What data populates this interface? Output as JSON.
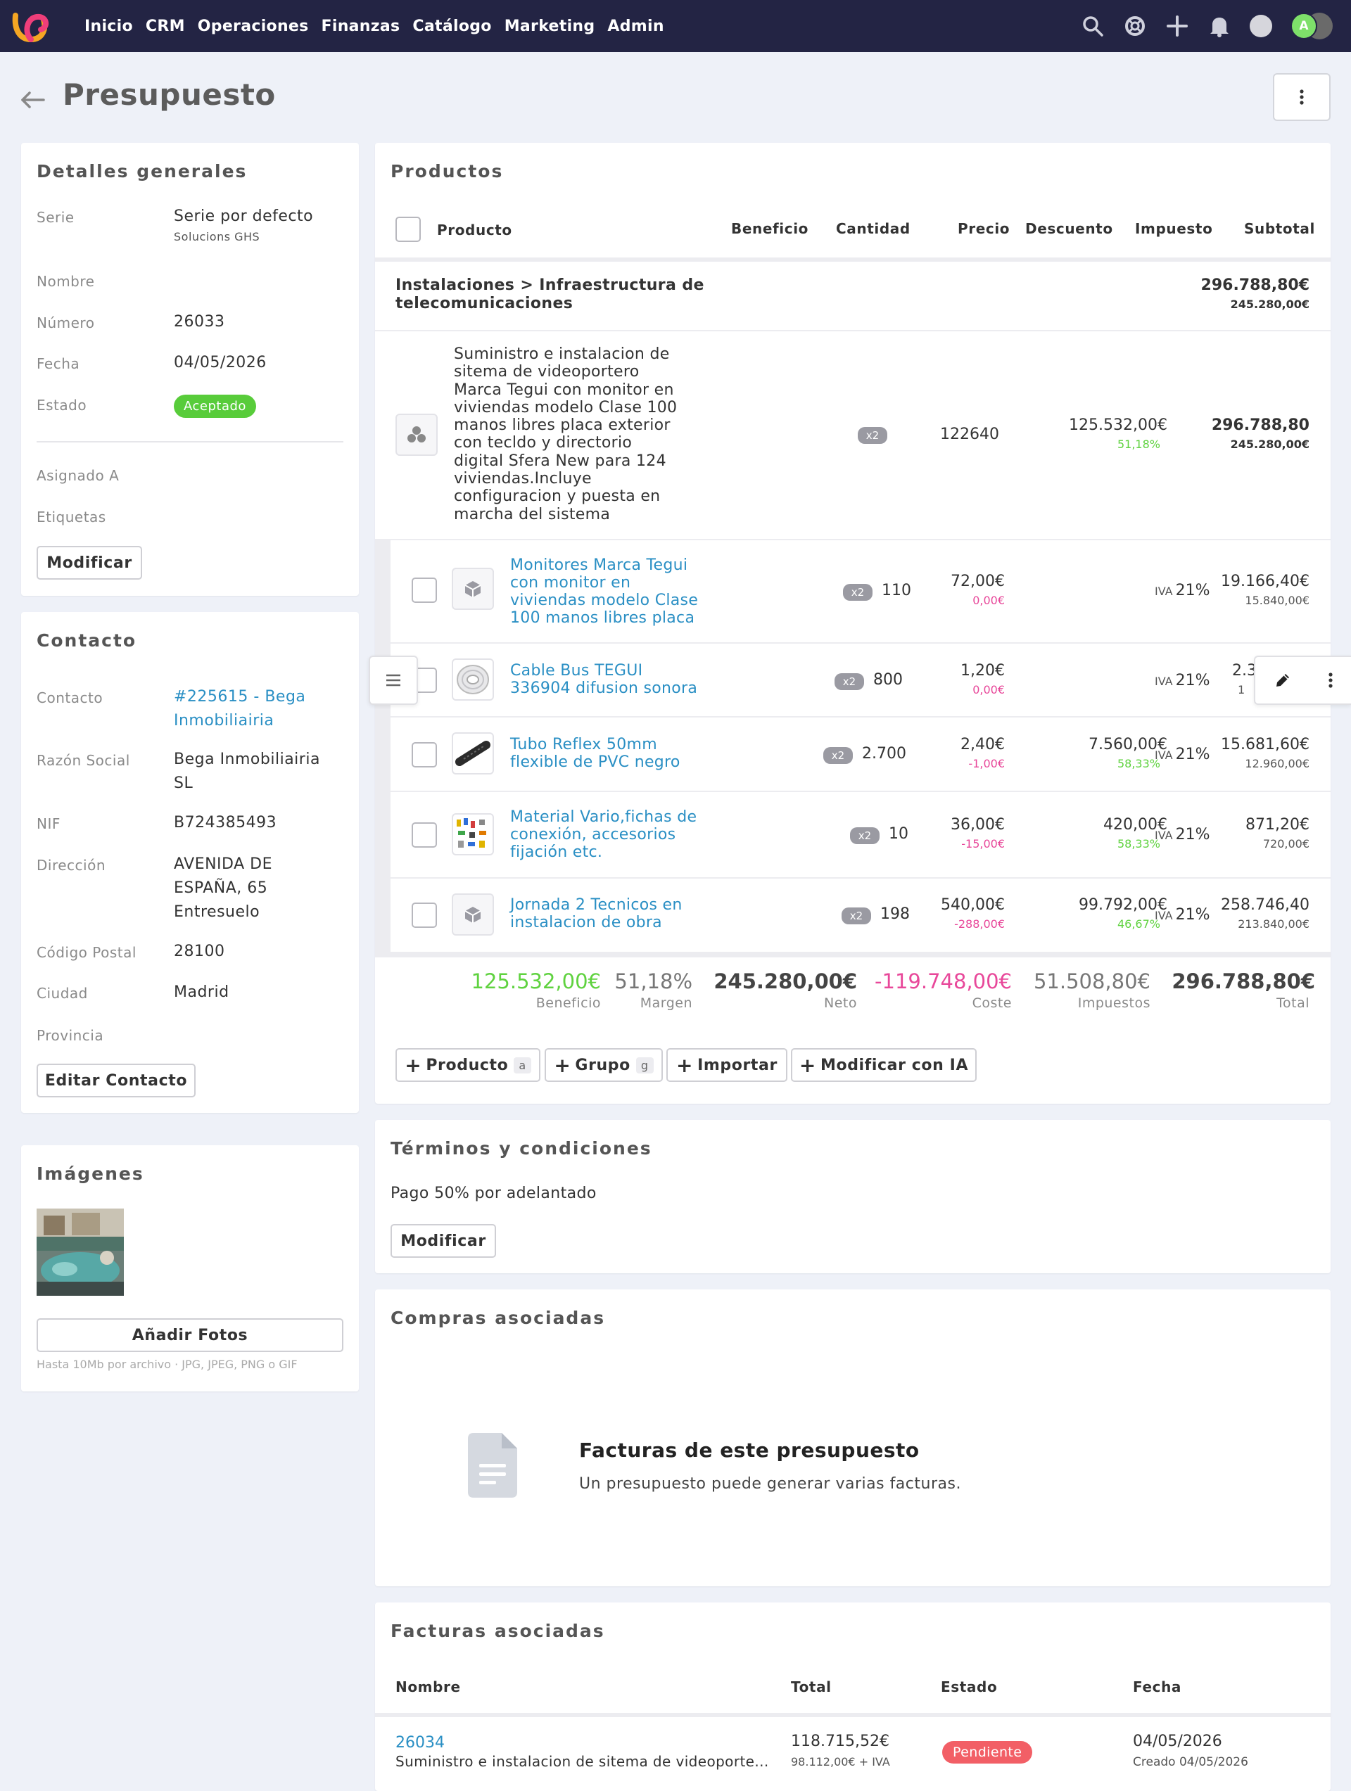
{
  "nav": {
    "links": [
      "Inicio",
      "CRM",
      "Operaciones",
      "Finanzas",
      "Catálogo",
      "Marketing",
      "Admin"
    ],
    "icons": [
      "search-icon",
      "lifebuoy-icon",
      "plus-icon",
      "bell-icon"
    ],
    "avatar_initial": "A"
  },
  "page": {
    "title": "Presupuesto"
  },
  "details": {
    "title": "Detalles generales",
    "serie_label": "Serie",
    "serie_value": "Serie por defecto",
    "serie_sub": "Solucions GHS",
    "nombre_label": "Nombre",
    "numero_label": "Número",
    "numero_value": "26033",
    "fecha_label": "Fecha",
    "fecha_value": "04/05/2026",
    "estado_label": "Estado",
    "estado_value": "Aceptado",
    "asignado_label": "Asignado A",
    "etiquetas_label": "Etiquetas",
    "modify_label": "Modificar"
  },
  "contact": {
    "title": "Contacto",
    "contacto_label": "Contacto",
    "contacto_line1": "#225615 - Bega",
    "contacto_line2": "Inmobiliairia",
    "razon_label": "Razón Social",
    "razon_line1": "Bega Inmobiliairia",
    "razon_line2": "SL",
    "nif_label": "NIF",
    "nif_value": "B724385493",
    "dir_label": "Dirección",
    "dir_line1": "AVENIDA DE",
    "dir_line2": "ESPAÑA, 65",
    "dir_line3": "Entresuelo",
    "cp_label": "Código Postal",
    "cp_value": "28100",
    "ciudad_label": "Ciudad",
    "ciudad_value": "Madrid",
    "provincia_label": "Provincia",
    "edit_label": "Editar Contacto"
  },
  "images": {
    "title": "Imágenes",
    "add_label": "Añadir Fotos",
    "hint": "Hasta 10Mb por archivo · JPG, JPEG, PNG o GIF"
  },
  "products": {
    "title": "Productos",
    "headers": {
      "producto": "Producto",
      "beneficio": "Beneficio",
      "cantidad": "Cantidad",
      "precio": "Precio",
      "descuento": "Descuento",
      "impuesto": "Impuesto",
      "subtotal": "Subtotal"
    },
    "group": {
      "line1": "Instalaciones > Infraestructura de",
      "line2": "telecomunicaciones",
      "total": "296.788,80€",
      "net": "245.280,00€"
    },
    "bundle": {
      "lines": [
        "Suministro e instalacion de",
        "sitema de videoportero",
        "Marca Tegui con monitor en",
        "viviendas modelo Clase 100",
        "manos libres placa exterior",
        "con tecldo y directorio",
        "digital Sfera New para 124",
        "viviendas.Incluye",
        "configuracion y puesta en",
        "marcha del sistema"
      ],
      "benefit": "125.532,00€",
      "margin": "51,18%",
      "qty_pill": "x2",
      "price": "122640",
      "total": "296.788,80",
      "net": "245.280,00€"
    },
    "items": [
      {
        "lines": [
          "Monitores Marca Tegui",
          "con monitor en",
          "viviendas modelo Clase",
          "100 manos libres placa"
        ],
        "benefit": "",
        "margin": "",
        "pill": "x2",
        "qty": "110",
        "price": "72,00€",
        "discount": "0,00€",
        "tax_label": "IVA",
        "tax": "21%",
        "subtotal": "19.166,40€",
        "net": "15.840,00€",
        "thumb": "box-icon"
      },
      {
        "lines": [
          "Cable Bus TEGUI",
          "336904 difusion sonora"
        ],
        "benefit": "",
        "margin": "",
        "pill": "x2",
        "qty": "800",
        "price": "1,20€",
        "discount": "0,00€",
        "tax_label": "IVA",
        "tax": "21%",
        "subtotal": "2.3",
        "net": "1",
        "thumb": "cable-icon"
      },
      {
        "lines": [
          "Tubo Reflex 50mm",
          "flexible de PVC negro"
        ],
        "benefit": "7.560,00€",
        "margin": "58,33%",
        "pill": "x2",
        "qty": "2.700",
        "price": "2,40€",
        "discount": "-1,00€",
        "tax_label": "IVA",
        "tax": "21%",
        "subtotal": "15.681,60€",
        "net": "12.960,00€",
        "thumb": "tube-icon"
      },
      {
        "lines": [
          "Material Vario,fichas de",
          "conexión, accesorios",
          "fijación etc."
        ],
        "benefit": "420,00€",
        "margin": "58,33%",
        "pill": "x2",
        "qty": "10",
        "price": "36,00€",
        "discount": "-15,00€",
        "tax_label": "IVA",
        "tax": "21%",
        "subtotal": "871,20€",
        "net": "720,00€",
        "thumb": "materials-icon"
      },
      {
        "lines": [
          "Jornada 2 Tecnicos en",
          "instalacion de obra"
        ],
        "benefit": "99.792,00€",
        "margin": "46,67%",
        "pill": "x2",
        "qty": "198",
        "price": "540,00€",
        "discount": "-288,00€",
        "tax_label": "IVA",
        "tax": "21%",
        "subtotal": "258.746,40",
        "net": "213.840,00€",
        "thumb": "box-icon"
      }
    ],
    "totals": [
      {
        "value": "125.532,00€",
        "label": "Beneficio",
        "color": "#5fd23f"
      },
      {
        "value": "51,18%",
        "label": "Margen",
        "color": "#777777"
      },
      {
        "value": "245.280,00€",
        "label": "Neto",
        "color": "#444444"
      },
      {
        "value": "-119.748,00€",
        "label": "Coste",
        "color": "#e8489a"
      },
      {
        "value": "51.508,80€",
        "label": "Impuestos",
        "color": "#777777"
      },
      {
        "value": "296.788,80€",
        "label": "Total",
        "color": "#444444"
      }
    ],
    "buttons": {
      "producto": "Producto",
      "producto_key": "a",
      "grupo": "Grupo",
      "grupo_key": "g",
      "importar": "Importar",
      "ia": "Modificar con IA"
    }
  },
  "terms": {
    "title": "Términos y condiciones",
    "text": "Pago 50% por adelantado",
    "modify_label": "Modificar"
  },
  "purchases": {
    "title": "Compras asociadas",
    "empty_title": "Facturas de este presupuesto",
    "empty_text": "Un presupuesto puede generar varias facturas."
  },
  "invoices": {
    "title": "Facturas asociadas",
    "headers": {
      "nombre": "Nombre",
      "total": "Total",
      "estado": "Estado",
      "fecha": "Fecha"
    },
    "rows": [
      {
        "number": "26034",
        "desc": "Suministro e instalacion de sitema de videoporte...",
        "total": "118.715,52€",
        "total_sub": "98.112,00€ + IVA",
        "status": "Pendiente",
        "date": "04/05/2026",
        "created": "Creado 04/05/2026"
      }
    ]
  },
  "colors": {
    "accent_link": "#2a8fc4",
    "status_green": "#58cc3a",
    "status_red": "#f25f66",
    "nav_bg": "#232444"
  }
}
